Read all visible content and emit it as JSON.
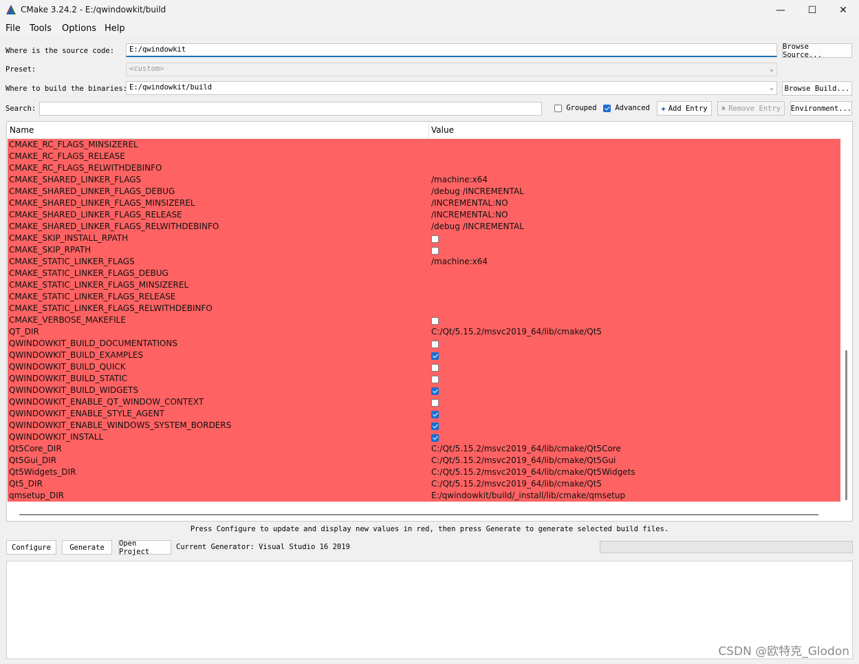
{
  "window": {
    "title": "CMake 3.24.2 - E:/qwindowkit/build"
  },
  "menu": [
    "File",
    "Tools",
    "Options",
    "Help"
  ],
  "source": {
    "label": "Where is the source code:",
    "value": "E:/qwindowkit",
    "browse": "Browse Source..."
  },
  "preset": {
    "label": "Preset:",
    "value": "<custom>"
  },
  "binaries": {
    "label": "Where to build the binaries:",
    "value": "E:/qwindowkit/build",
    "browse": "Browse Build..."
  },
  "search": {
    "label": "Search:",
    "value": ""
  },
  "toolbar": {
    "grouped": "Grouped",
    "grouped_checked": false,
    "advanced": "Advanced",
    "advanced_checked": true,
    "add_entry": "Add Entry",
    "remove_entry": "Remove Entry",
    "environment": "Environment..."
  },
  "table": {
    "headers": [
      "Name",
      "Value"
    ],
    "row_color": "#ff6262",
    "rows": [
      {
        "name": "CMAKE_RC_FLAGS_MINSIZEREL",
        "type": "text",
        "value": ""
      },
      {
        "name": "CMAKE_RC_FLAGS_RELEASE",
        "type": "text",
        "value": ""
      },
      {
        "name": "CMAKE_RC_FLAGS_RELWITHDEBINFO",
        "type": "text",
        "value": ""
      },
      {
        "name": "CMAKE_SHARED_LINKER_FLAGS",
        "type": "text",
        "value": "/machine:x64"
      },
      {
        "name": "CMAKE_SHARED_LINKER_FLAGS_DEBUG",
        "type": "text",
        "value": "/debug /INCREMENTAL"
      },
      {
        "name": "CMAKE_SHARED_LINKER_FLAGS_MINSIZEREL",
        "type": "text",
        "value": "/INCREMENTAL:NO"
      },
      {
        "name": "CMAKE_SHARED_LINKER_FLAGS_RELEASE",
        "type": "text",
        "value": "/INCREMENTAL:NO"
      },
      {
        "name": "CMAKE_SHARED_LINKER_FLAGS_RELWITHDEBINFO",
        "type": "text",
        "value": "/debug /INCREMENTAL"
      },
      {
        "name": "CMAKE_SKIP_INSTALL_RPATH",
        "type": "bool",
        "checked": false
      },
      {
        "name": "CMAKE_SKIP_RPATH",
        "type": "bool",
        "checked": false
      },
      {
        "name": "CMAKE_STATIC_LINKER_FLAGS",
        "type": "text",
        "value": "/machine:x64"
      },
      {
        "name": "CMAKE_STATIC_LINKER_FLAGS_DEBUG",
        "type": "text",
        "value": ""
      },
      {
        "name": "CMAKE_STATIC_LINKER_FLAGS_MINSIZEREL",
        "type": "text",
        "value": ""
      },
      {
        "name": "CMAKE_STATIC_LINKER_FLAGS_RELEASE",
        "type": "text",
        "value": ""
      },
      {
        "name": "CMAKE_STATIC_LINKER_FLAGS_RELWITHDEBINFO",
        "type": "text",
        "value": ""
      },
      {
        "name": "CMAKE_VERBOSE_MAKEFILE",
        "type": "bool",
        "checked": false
      },
      {
        "name": "QT_DIR",
        "type": "text",
        "value": "C:/Qt/5.15.2/msvc2019_64/lib/cmake/Qt5"
      },
      {
        "name": "QWINDOWKIT_BUILD_DOCUMENTATIONS",
        "type": "bool",
        "checked": false
      },
      {
        "name": "QWINDOWKIT_BUILD_EXAMPLES",
        "type": "bool",
        "checked": true
      },
      {
        "name": "QWINDOWKIT_BUILD_QUICK",
        "type": "bool",
        "checked": false
      },
      {
        "name": "QWINDOWKIT_BUILD_STATIC",
        "type": "bool",
        "checked": false
      },
      {
        "name": "QWINDOWKIT_BUILD_WIDGETS",
        "type": "bool",
        "checked": true
      },
      {
        "name": "QWINDOWKIT_ENABLE_QT_WINDOW_CONTEXT",
        "type": "bool",
        "checked": false
      },
      {
        "name": "QWINDOWKIT_ENABLE_STYLE_AGENT",
        "type": "bool",
        "checked": true
      },
      {
        "name": "QWINDOWKIT_ENABLE_WINDOWS_SYSTEM_BORDERS",
        "type": "bool",
        "checked": true
      },
      {
        "name": "QWINDOWKIT_INSTALL",
        "type": "bool",
        "checked": true
      },
      {
        "name": "Qt5Core_DIR",
        "type": "text",
        "value": "C:/Qt/5.15.2/msvc2019_64/lib/cmake/Qt5Core"
      },
      {
        "name": "Qt5Gui_DIR",
        "type": "text",
        "value": "C:/Qt/5.15.2/msvc2019_64/lib/cmake/Qt5Gui"
      },
      {
        "name": "Qt5Widgets_DIR",
        "type": "text",
        "value": "C:/Qt/5.15.2/msvc2019_64/lib/cmake/Qt5Widgets"
      },
      {
        "name": "Qt5_DIR",
        "type": "text",
        "value": "C:/Qt/5.15.2/msvc2019_64/lib/cmake/Qt5"
      },
      {
        "name": "qmsetup_DIR",
        "type": "text",
        "value": "E:/qwindowkit/build/_install/lib/cmake/qmsetup"
      }
    ]
  },
  "hint": "Press Configure to update and display new values in red, then press Generate to generate selected build files.",
  "actions": {
    "configure": "Configure",
    "generate": "Generate",
    "open_project": "Open Project",
    "generator": "Current Generator: Visual Studio 16 2019"
  },
  "watermark": "CSDN @欧特克_Glodon"
}
